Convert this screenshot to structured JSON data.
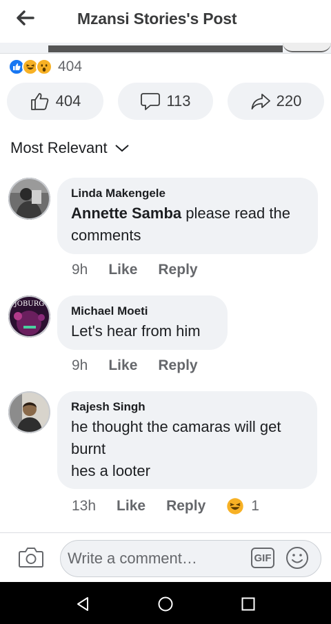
{
  "header": {
    "title": "Mzansi Stories's Post"
  },
  "reaction_summary": {
    "count": "404",
    "icons": [
      "like-icon",
      "haha-icon",
      "wow-icon"
    ]
  },
  "actions": {
    "like_count": "404",
    "comment_count": "113",
    "share_count": "220"
  },
  "sort": {
    "label": "Most Relevant"
  },
  "comments": [
    {
      "author": "Linda Makengele",
      "mention": "Annette Samba",
      "text": " please read the comments",
      "time": "9h",
      "like_label": "Like",
      "reply_label": "Reply"
    },
    {
      "author": "Michael Moeti",
      "text": "Let's hear from him",
      "time": "9h",
      "like_label": "Like",
      "reply_label": "Reply",
      "avatar_text": "JOBURG"
    },
    {
      "author": "Rajesh Singh",
      "lines": [
        "he thought the camaras will get",
        "burnt",
        "hes a looter"
      ],
      "time": "13h",
      "like_label": "Like",
      "reply_label": "Reply",
      "reaction_count": "1"
    }
  ],
  "composer": {
    "placeholder": "Write a comment…",
    "gif_label": "GIF"
  },
  "colors": {
    "accent": "#1877f2",
    "bubble": "#f0f2f5",
    "muted": "#65676b",
    "haha": "#f7b125"
  }
}
